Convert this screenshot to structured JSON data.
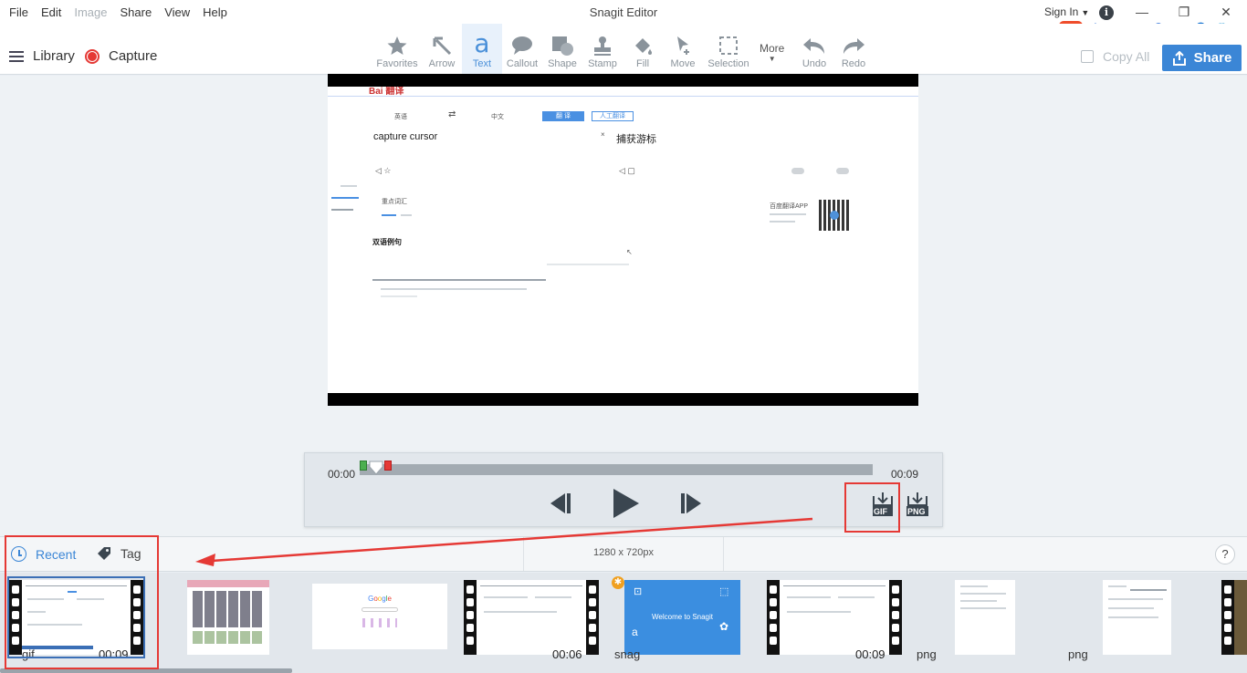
{
  "window": {
    "title": "Snagit Editor"
  },
  "menu": {
    "items": [
      {
        "label": "File",
        "enabled": true
      },
      {
        "label": "Edit",
        "enabled": true
      },
      {
        "label": "Image",
        "enabled": false
      },
      {
        "label": "Share",
        "enabled": true
      },
      {
        "label": "View",
        "enabled": true
      },
      {
        "label": "Help",
        "enabled": true
      }
    ],
    "sign_in": "Sign In"
  },
  "ime": {
    "logo": "S",
    "mode": "中"
  },
  "toolbar": {
    "library": "Library",
    "capture": "Capture",
    "tools": [
      {
        "label": "Favorites",
        "icon": "star-icon"
      },
      {
        "label": "Arrow",
        "icon": "arrow-icon"
      },
      {
        "label": "Text",
        "icon": "text-icon",
        "active": true
      },
      {
        "label": "Callout",
        "icon": "callout-icon"
      },
      {
        "label": "Shape",
        "icon": "shape-icon"
      },
      {
        "label": "Stamp",
        "icon": "stamp-icon"
      },
      {
        "label": "Fill",
        "icon": "fill-icon"
      },
      {
        "label": "Move",
        "icon": "move-icon"
      },
      {
        "label": "Selection",
        "icon": "selection-icon"
      }
    ],
    "more": "More",
    "undo": "Undo",
    "redo": "Redo",
    "copy_all": "Copy All",
    "share": "Share",
    "accent": "#3b86d6"
  },
  "capture_preview": {
    "source_text": "capture cursor",
    "translated_text": "捕获游标",
    "lang_from": "英语",
    "lang_to": "中文",
    "translate_btn": "翻 译",
    "human_btn": "人工翻译",
    "section_title": "双语例句",
    "key_words": "重点词汇",
    "app_promo": "百度翻译APP"
  },
  "player": {
    "time_start": "00:00",
    "time_end": "00:09",
    "progress": 0,
    "export_gif": "GIF",
    "export_png": "PNG"
  },
  "tray": {
    "tab_recent": "Recent",
    "tab_tag": "Tag",
    "dimensions": "1280 x 720px",
    "help": "?",
    "items": [
      {
        "type": "gif",
        "duration": "00:09",
        "selected": true
      },
      {
        "type": "",
        "duration": ""
      },
      {
        "type": "",
        "duration": ""
      },
      {
        "type": "",
        "duration": "00:06"
      },
      {
        "type": "snag",
        "duration": "",
        "caption": "Welcome to Snagit"
      },
      {
        "type": "",
        "duration": "00:09"
      },
      {
        "type": "png",
        "duration": ""
      },
      {
        "type": "png",
        "duration": ""
      }
    ]
  },
  "colors": {
    "annotation_red": "#e53935",
    "accent_blue": "#3b86d6"
  }
}
